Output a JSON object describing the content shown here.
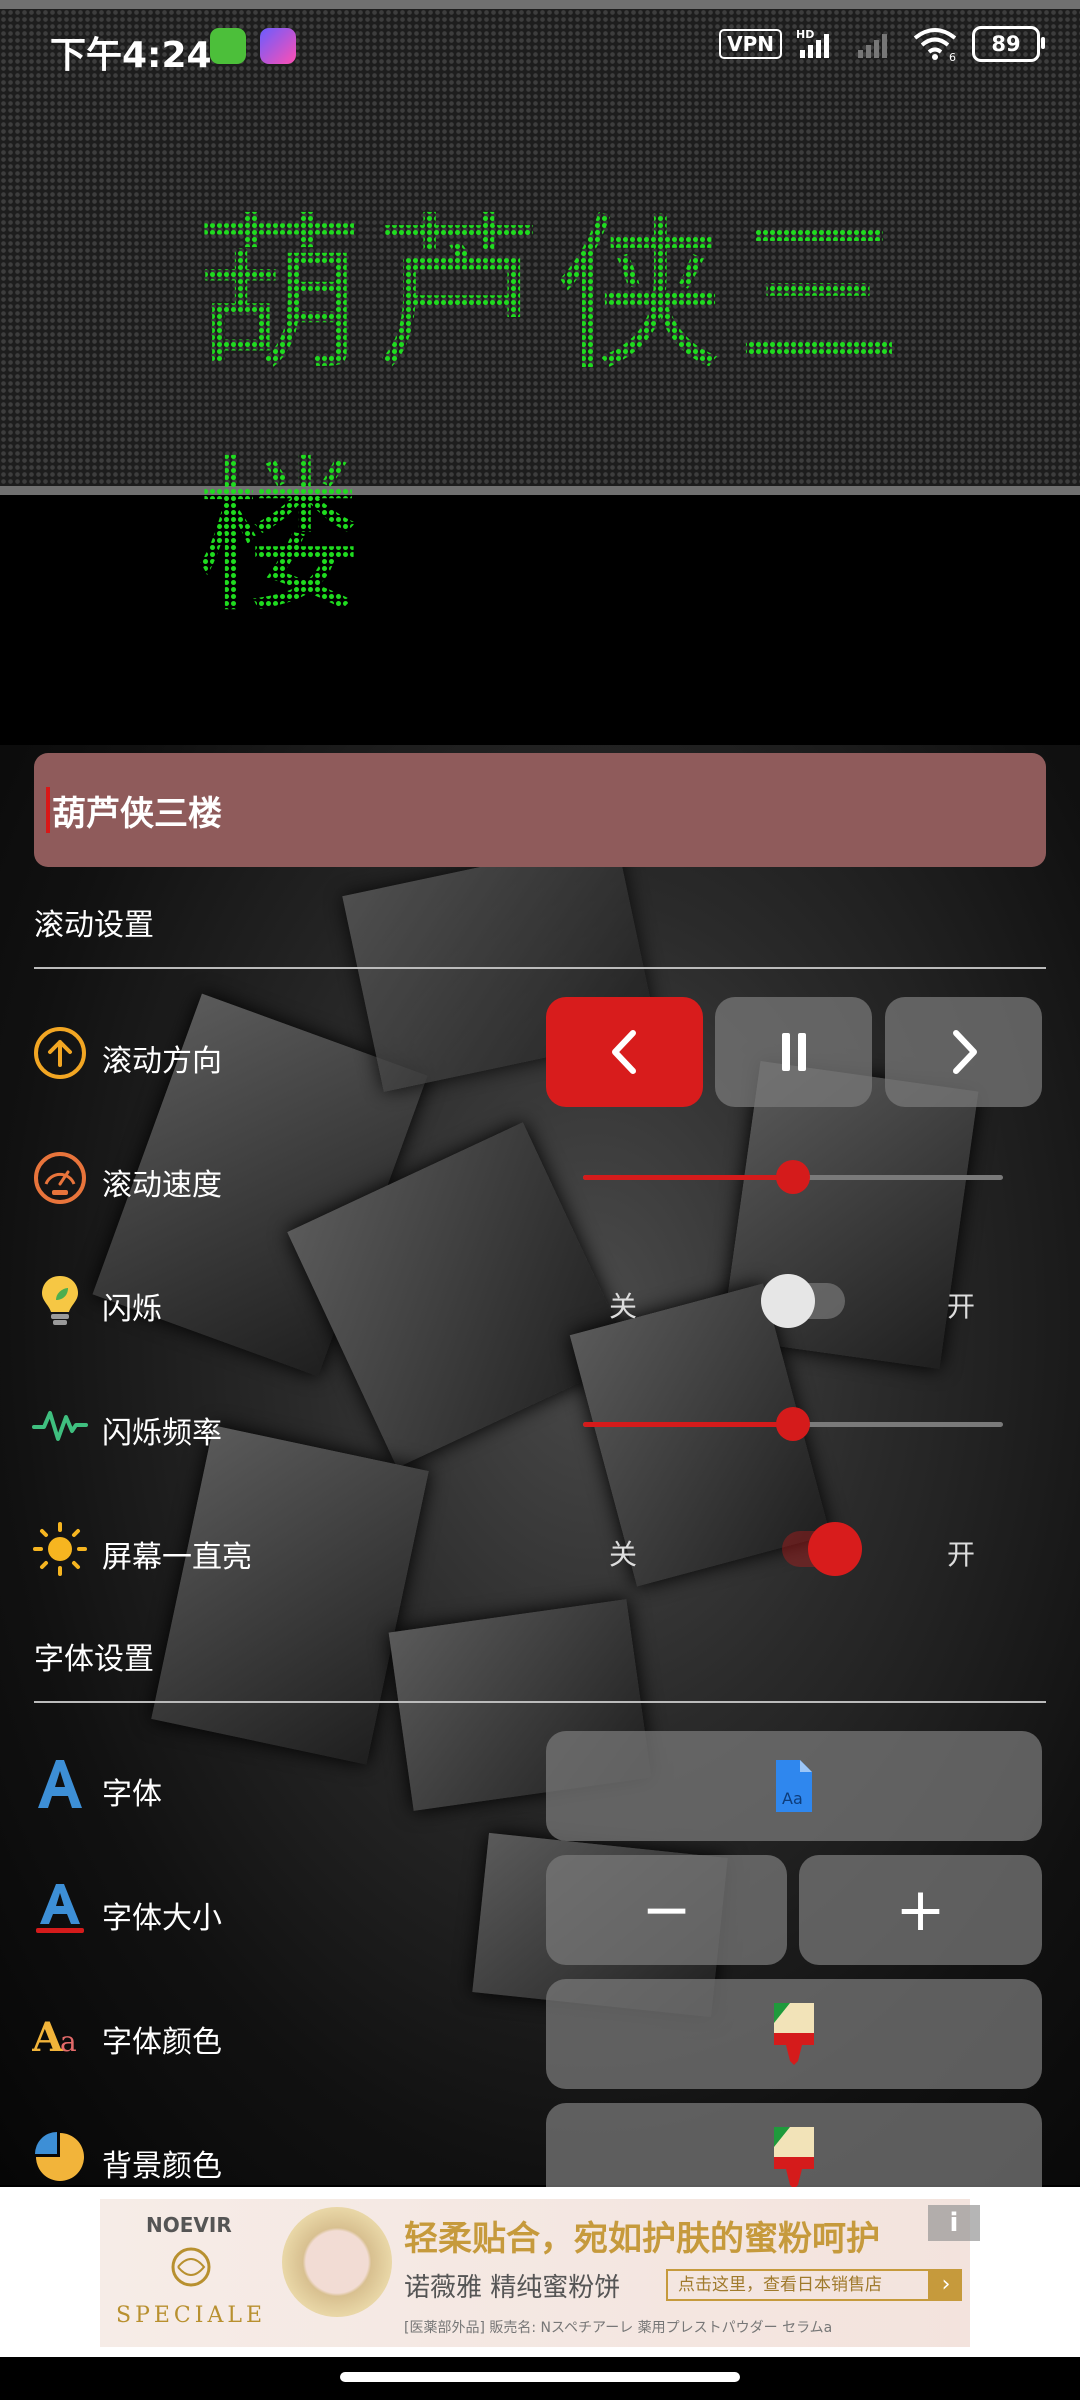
{
  "status_bar": {
    "time": "下午4:24",
    "vpn": "VPN",
    "network": "HD",
    "wifi_label": "6",
    "battery": "89"
  },
  "led_display": {
    "text": "葫芦侠三楼",
    "text_color": "#1fdc1f"
  },
  "input": {
    "value": "葫芦侠三楼"
  },
  "scroll_settings": {
    "title": "滚动设置",
    "direction_label": "滚动方向",
    "speed_label": "滚动速度",
    "speed_value": 0.5,
    "blink_label": "闪烁",
    "blink_off": "关",
    "blink_on": "开",
    "blink_enabled": false,
    "blink_freq_label": "闪烁频率",
    "blink_freq_value": 0.5,
    "keep_on_label": "屏幕一直亮",
    "keep_on_off": "关",
    "keep_on_on": "开",
    "keep_on_enabled": true
  },
  "font_settings": {
    "title": "字体设置",
    "font_label": "字体",
    "font_size_label": "字体大小",
    "font_color_label": "字体颜色",
    "bg_color_label": "背景颜色",
    "minus": "−",
    "plus": "+"
  },
  "ad": {
    "brand": "NOEVIR",
    "brand_sub": "SPECIALE",
    "headline": "轻柔贴合，宛如护肤的蜜粉呵护",
    "product": "诺薇雅 精纯蜜粉饼",
    "cta": "点击这里，查看日本销售店",
    "fineprint": "[医薬部外品] 販売名: Nスペチアーレ 薬用プレストパウダー セラムa",
    "info": "i"
  },
  "colors": {
    "accent": "#d81c1c",
    "input_bg": "#8f5b5b"
  }
}
